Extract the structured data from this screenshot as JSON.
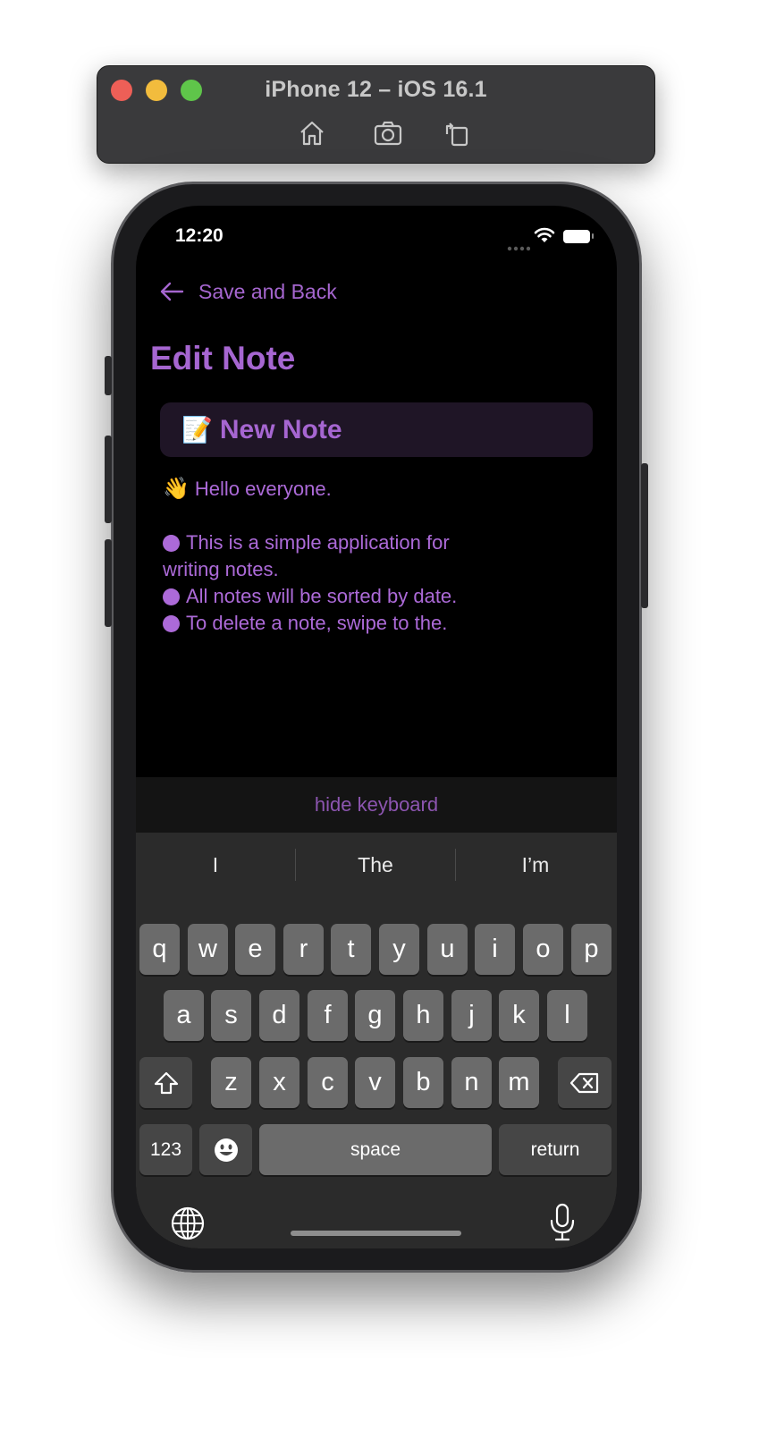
{
  "simulator": {
    "title": "iPhone 12 – iOS 16.1",
    "tools": [
      "home-icon",
      "screenshot-icon",
      "rotate-icon"
    ]
  },
  "status_bar": {
    "time": "12:20"
  },
  "nav": {
    "back_label": "Save and Back"
  },
  "page_title": "Edit Note",
  "note": {
    "title_emoji": "📝",
    "title": "New Note",
    "greeting_emoji": "👋",
    "greeting": "Hello everyone.",
    "lines": [
      "This is a simple application for",
      "writing notes.",
      "All notes will be sorted by date.",
      "To delete a note, swipe to the."
    ]
  },
  "accessory": {
    "hide_keyboard_label": "hide keyboard"
  },
  "keyboard": {
    "predictions": [
      "I",
      "The",
      "I’m"
    ],
    "row1": [
      "q",
      "w",
      "e",
      "r",
      "t",
      "y",
      "u",
      "i",
      "o",
      "p"
    ],
    "row2": [
      "a",
      "s",
      "d",
      "f",
      "g",
      "h",
      "j",
      "k",
      "l"
    ],
    "row3": [
      "z",
      "x",
      "c",
      "v",
      "b",
      "n",
      "m"
    ],
    "numbers_label": "123",
    "space_label": "space",
    "return_label": "return"
  },
  "colors": {
    "accent": "#a666d1",
    "title_field_bg": "#1f1526",
    "keyboard_bg": "#2b2b2b",
    "key_bg": "#6b6b6b"
  }
}
